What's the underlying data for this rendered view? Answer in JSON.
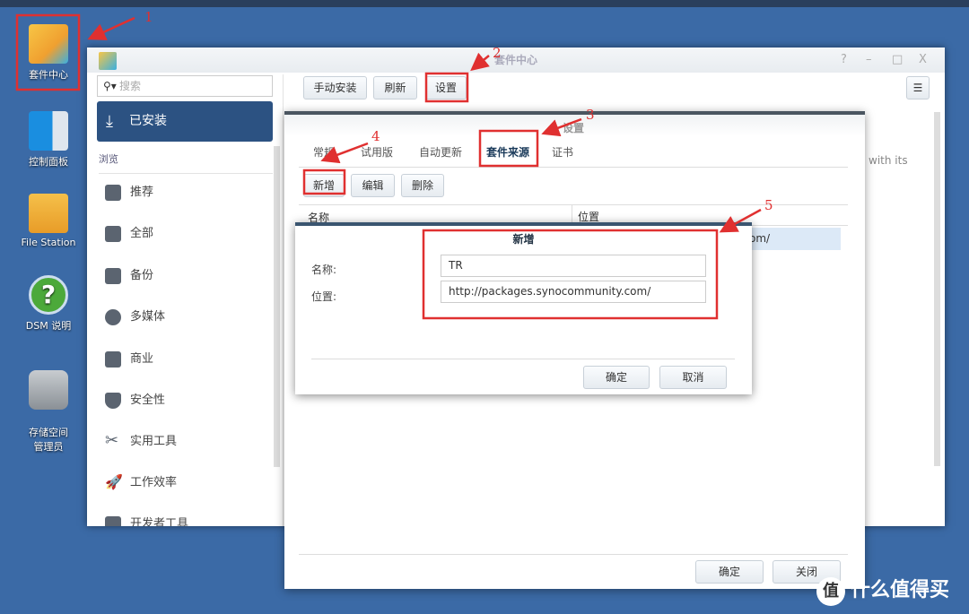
{
  "desktop": {
    "icons": [
      {
        "label": "套件中心"
      },
      {
        "label": "控制面板"
      },
      {
        "label": "File Station"
      },
      {
        "label": "DSM 说明"
      },
      {
        "label": "存储空间\n管理员"
      }
    ]
  },
  "window": {
    "title": "套件中心",
    "controls": [
      "?",
      "–",
      "□",
      "X"
    ],
    "search_placeholder": "搜索",
    "installed": "已安装",
    "browse": "浏览",
    "categories": [
      "推荐",
      "全部",
      "备份",
      "多媒体",
      "商业",
      "安全性",
      "实用工具",
      "工作效率",
      "开发者工具"
    ],
    "toolbar": {
      "manual_install": "手动安装",
      "refresh": "刷新",
      "settings": "设置"
    },
    "background_text": "with its"
  },
  "settings": {
    "title": "设置",
    "tabs": [
      "常规",
      "试用版",
      "自动更新",
      "套件来源",
      "证书"
    ],
    "active_tab": "套件来源",
    "actions": {
      "add": "新增",
      "edit": "编辑",
      "delete": "删除"
    },
    "columns": [
      "名称",
      "位置"
    ],
    "row_fragment": "om/",
    "ok": "确定",
    "close": "关闭"
  },
  "add_dialog": {
    "title": "新增",
    "name_label": "名称:",
    "location_label": "位置:",
    "name_value": "TR",
    "location_value": "http://packages.synocommunity.com/",
    "ok": "确定",
    "cancel": "取消"
  },
  "annotations": [
    "1",
    "2",
    "3",
    "4",
    "5"
  ],
  "watermark": {
    "glyph": "值",
    "text": "什么值得买"
  },
  "colors": {
    "annotation": "#e03030",
    "selected_nav": "#2c5282",
    "desktop": "#3b6aa6"
  }
}
